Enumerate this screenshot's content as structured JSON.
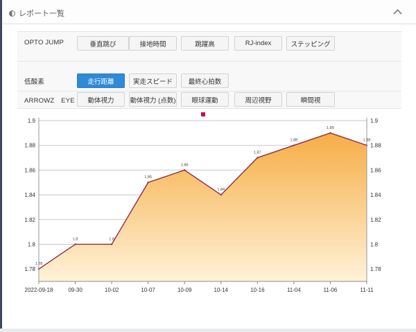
{
  "panel": {
    "title": "レポート一覧",
    "icon": "half-circle-icon",
    "collapse_icon": "chevron-up-icon"
  },
  "table": {
    "rows": [
      {
        "label": "OPTO JUMP",
        "buttons": [
          "垂直跳び",
          "接地時間",
          "跳躍高",
          "RJ-index",
          "ステッピング"
        ]
      },
      {
        "label": "低酸素",
        "buttons": [
          "走行距離",
          "実走スピード",
          "最終心拍数"
        ],
        "active_button": "走行距離"
      },
      {
        "label": "ARROWZ　EYE",
        "buttons": [
          "動体視力",
          "動体視力 (点数)",
          "眼球運動",
          "周辺視野",
          "瞬間視"
        ]
      }
    ]
  },
  "colors": {
    "accent": "#2f8ad8",
    "line": "#8e2a45",
    "area_top": "#f6a93c",
    "area_bottom": "#fff1d6",
    "legend_marker": "#c8104a"
  },
  "chart_data": {
    "type": "area",
    "categories": [
      "2022-09-18",
      "09-30",
      "10-02",
      "10-07",
      "10-09",
      "10-14",
      "10-16",
      "11-04",
      "11-06",
      "11-11"
    ],
    "series": [
      {
        "values": [
          1.78,
          1.8,
          1.8,
          1.85,
          1.86,
          1.84,
          1.87,
          1.88,
          1.89,
          1.88
        ]
      }
    ],
    "data_labels": [
      "1.78",
      "1.8",
      "1.8",
      "1.85",
      "1.86",
      "1.84",
      "1.87",
      "1.88",
      "1.89",
      "1.88"
    ],
    "ylim": [
      1.77,
      1.9
    ],
    "yticks": [
      "1.9",
      "1.88",
      "1.86",
      "1.84",
      "1.82",
      "1.8",
      "1.78"
    ],
    "y_right_axis": true,
    "grid": true,
    "legend": "top-center",
    "title": "",
    "xlabel": "",
    "ylabel": ""
  }
}
